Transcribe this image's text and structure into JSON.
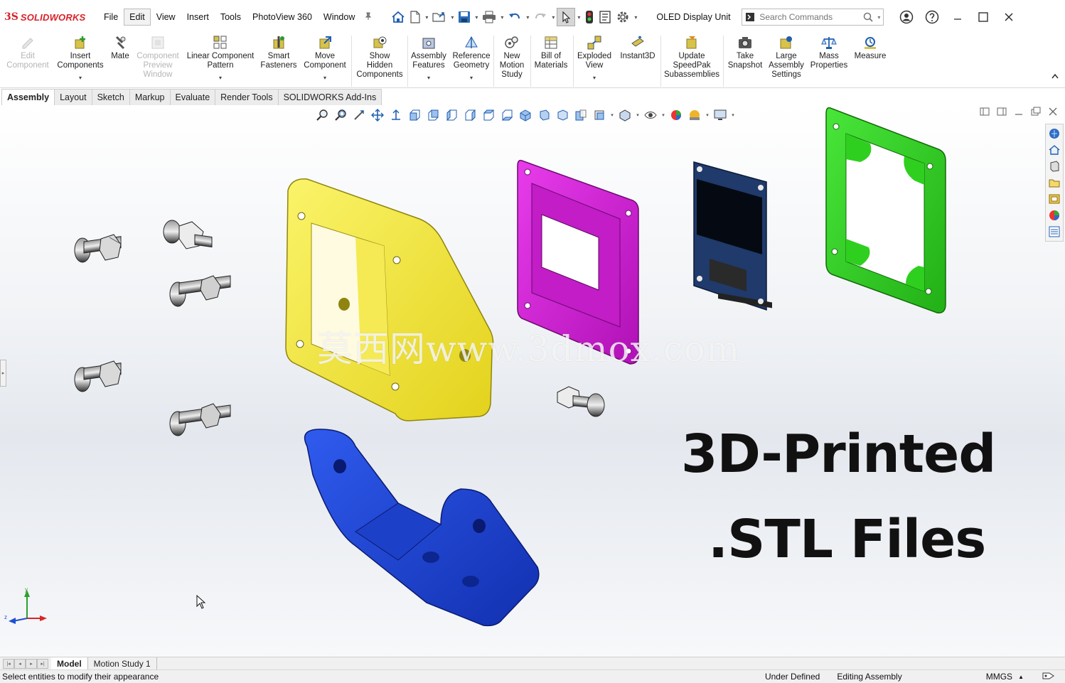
{
  "app": {
    "brand_mark": "3S",
    "brand_name": "SOLIDWORKS",
    "document_title": "OLED Display Unit"
  },
  "menu": [
    "File",
    "Edit",
    "View",
    "Insert",
    "Tools",
    "PhotoView 360",
    "Window"
  ],
  "active_menu": "Edit",
  "search": {
    "placeholder": "Search Commands"
  },
  "commands": [
    {
      "label": "Edit\nComponent",
      "icon": "edit-component-icon",
      "enabled": false
    },
    {
      "label": "Insert\nComponents",
      "icon": "insert-components-icon",
      "enabled": true
    },
    {
      "label": "Mate",
      "icon": "mate-icon",
      "enabled": true
    },
    {
      "label": "Component\nPreview\nWindow",
      "icon": "component-preview-icon",
      "enabled": false
    },
    {
      "label": "Linear Component\nPattern",
      "icon": "linear-pattern-icon",
      "enabled": true
    },
    {
      "label": "Smart\nFasteners",
      "icon": "smart-fasteners-icon",
      "enabled": true
    },
    {
      "label": "Move\nComponent",
      "icon": "move-component-icon",
      "enabled": true
    },
    {
      "label": "Show\nHidden\nComponents",
      "icon": "show-hidden-icon",
      "enabled": true
    },
    {
      "label": "Assembly\nFeatures",
      "icon": "assembly-features-icon",
      "enabled": true
    },
    {
      "label": "Reference\nGeometry",
      "icon": "reference-geometry-icon",
      "enabled": true
    },
    {
      "label": "New\nMotion\nStudy",
      "icon": "motion-study-icon",
      "enabled": true
    },
    {
      "label": "Bill of\nMaterials",
      "icon": "bill-of-materials-icon",
      "enabled": true
    },
    {
      "label": "Exploded\nView",
      "icon": "exploded-view-icon",
      "enabled": true
    },
    {
      "label": "Instant3D",
      "icon": "instant3d-icon",
      "enabled": true
    },
    {
      "label": "Update\nSpeedPak\nSubassemblies",
      "icon": "speedpak-icon",
      "enabled": true
    },
    {
      "label": "Take\nSnapshot",
      "icon": "snapshot-icon",
      "enabled": true
    },
    {
      "label": "Large\nAssembly\nSettings",
      "icon": "large-assembly-icon",
      "enabled": true
    },
    {
      "label": "Mass\nProperties",
      "icon": "mass-properties-icon",
      "enabled": true
    },
    {
      "label": "Measure",
      "icon": "measure-icon",
      "enabled": true
    }
  ],
  "tabs": [
    "Assembly",
    "Layout",
    "Sketch",
    "Markup",
    "Evaluate",
    "Render Tools",
    "SOLIDWORKS Add-Ins"
  ],
  "active_tab": "Assembly",
  "viewport": {
    "watermark": "莫西网www.3dmox.com",
    "overlay_line1": "3D-Printed",
    "overlay_line2": ".STL Files",
    "triad": {
      "x": "x",
      "y": "y",
      "z": "z"
    }
  },
  "part_colors": {
    "frame": "#f2e63a",
    "bezel": "#d21fd6",
    "bracket": "#1a3fd0",
    "back_frame": "#2fcf1f",
    "pcb": "#1f3a6b"
  },
  "bottom_tabs": [
    "Model",
    "Motion Study 1"
  ],
  "active_bottom_tab": "Model",
  "status": {
    "message": "Select entities to modify their appearance",
    "definition": "Under Defined",
    "mode": "Editing Assembly",
    "units": "MMGS",
    "units_arrow": "▲"
  }
}
